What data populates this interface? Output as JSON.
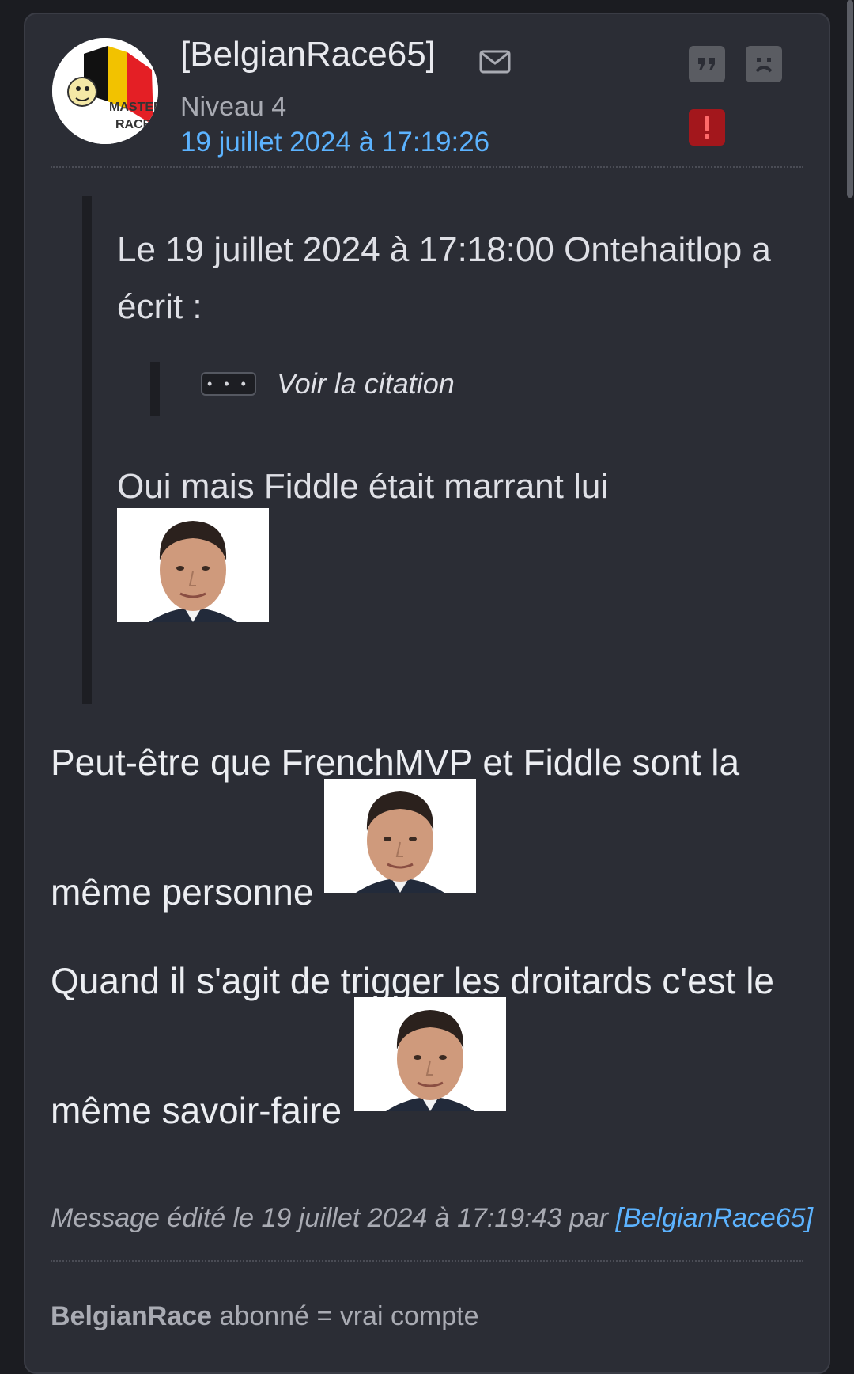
{
  "post": {
    "author": "[BelgianRace65]",
    "level": "Niveau 4",
    "date": "19 juillet 2024 à 17:19:26",
    "avatar_text_top": "MASTER",
    "avatar_text_bottom": "RACE",
    "icons": {
      "mail": "mail-icon",
      "quote": "quote-icon",
      "sad": "sad-face-icon",
      "report": "exclamation-icon"
    }
  },
  "quote": {
    "header": "Le 19 juillet 2024 à 17:18:00 Ontehaitlop a écrit :",
    "dots": "• • •",
    "voir_citation": "Voir la citation",
    "text": "Oui mais Fiddle était marrant lui"
  },
  "body": {
    "line1": "Peut-être que FrenchMVP et Fiddle sont la",
    "line2": "même personne",
    "line3": "Quand il s'agit de trigger les droitards c'est le",
    "line4": "même savoir-faire"
  },
  "edited": {
    "prefix": "Message édité le 19 juillet 2024 à 17:19:43 par",
    "author": "[BelgianRace65]"
  },
  "signature": {
    "bold": "BelgianRace",
    "rest": "abonné = vrai compte"
  },
  "colors": {
    "background": "#1b1c21",
    "card": "#2b2d35",
    "link": "#5cb3ff",
    "muted": "#a9abb3",
    "report": "#a3171c"
  }
}
